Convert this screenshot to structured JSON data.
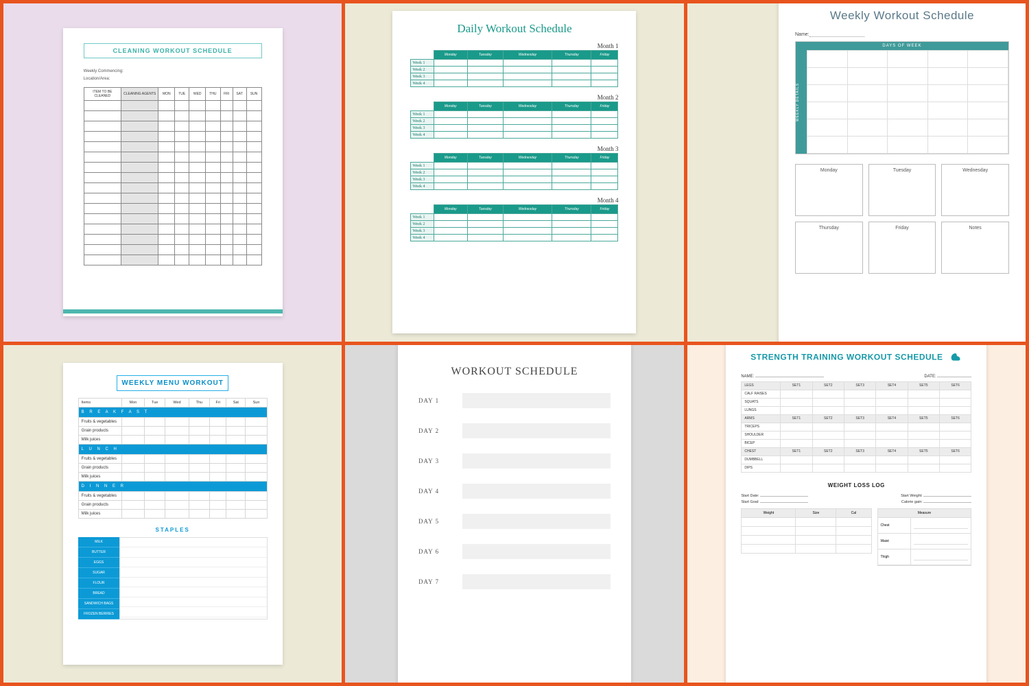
{
  "c1": {
    "title": "CLEANING WORKOUT SCHEDULE",
    "sub1": "Weekly Commencing:",
    "sub2": "Location/Area:",
    "cols": [
      "ITEM TO BE CLEANED",
      "CLEANING AGENTS",
      "MON",
      "TUE",
      "WED",
      "THU",
      "FRI",
      "SAT",
      "SUN"
    ]
  },
  "c2": {
    "title": "Daily Workout Schedule",
    "months": [
      "Month 1",
      "Month 2",
      "Month 3",
      "Month 4"
    ],
    "days": [
      "Monday",
      "Tuesday",
      "Wednesday",
      "Thursday",
      "Friday"
    ],
    "weeks": [
      "Week 1",
      "Week 2",
      "Week 3",
      "Week 4"
    ]
  },
  "c3": {
    "title": "Weekly Workout Schedule",
    "name_label": "Name:",
    "band_top": "DAYS OF WEEK",
    "band_side": "WEEKLY DETAILS",
    "boxes": [
      "Monday",
      "Tuesday",
      "Wednesday",
      "Thursday",
      "Friday",
      "Notes"
    ]
  },
  "c4": {
    "title": "WEEKLY MENU WORKOUT",
    "cols": [
      "Items",
      "Mon",
      "Tue",
      "Wed",
      "Thu",
      "Fri",
      "Sat",
      "Sun"
    ],
    "sections": [
      "B R E A K F A S T",
      "L U N C H",
      "D I N N E R"
    ],
    "rows": [
      "Fruits & vegetables",
      "Grain products",
      "Milk juices"
    ],
    "staples_title": "STAPLES",
    "staples": [
      "MILK",
      "BUTTER",
      "EGGS",
      "SUGAR",
      "FLOUR",
      "BREAD",
      "SANDWICH BAGS",
      "FROZEN BERRIES"
    ]
  },
  "c5": {
    "title": "WORKOUT SCHEDULE",
    "days": [
      "DAY 1",
      "DAY 2",
      "DAY 3",
      "DAY 4",
      "DAY 5",
      "DAY 6",
      "DAY 7"
    ]
  },
  "c6": {
    "title": "STRENGTH TRAINING WORKOUT SCHEDULE",
    "name_label": "NAME:",
    "date_label": "DATE:",
    "sets": [
      "SET1",
      "SET2",
      "SET3",
      "SET4",
      "SET5",
      "SET6"
    ],
    "groups": [
      {
        "head": "LEGS",
        "rows": [
          "CALF RAISES",
          "SQUATS",
          "LUNGS"
        ]
      },
      {
        "head": "ARMS",
        "rows": [
          "TRICEPS",
          "SHOULDER",
          "BICEP"
        ]
      },
      {
        "head": "CHEST",
        "rows": [
          "DUMBBELL",
          "DIPS"
        ]
      }
    ],
    "log_title": "WEIGHT LOSS LOG",
    "log_meta1a": "Start Date:",
    "log_meta1b": "Start Weight:",
    "log_meta2a": "Start Goal:",
    "log_meta2b": "Calorie gain:",
    "log_cols": [
      "Weight",
      "Size",
      "Cal"
    ],
    "measure": "Measure",
    "measure_rows": [
      "Chest",
      "Waist",
      "Thigh"
    ]
  }
}
